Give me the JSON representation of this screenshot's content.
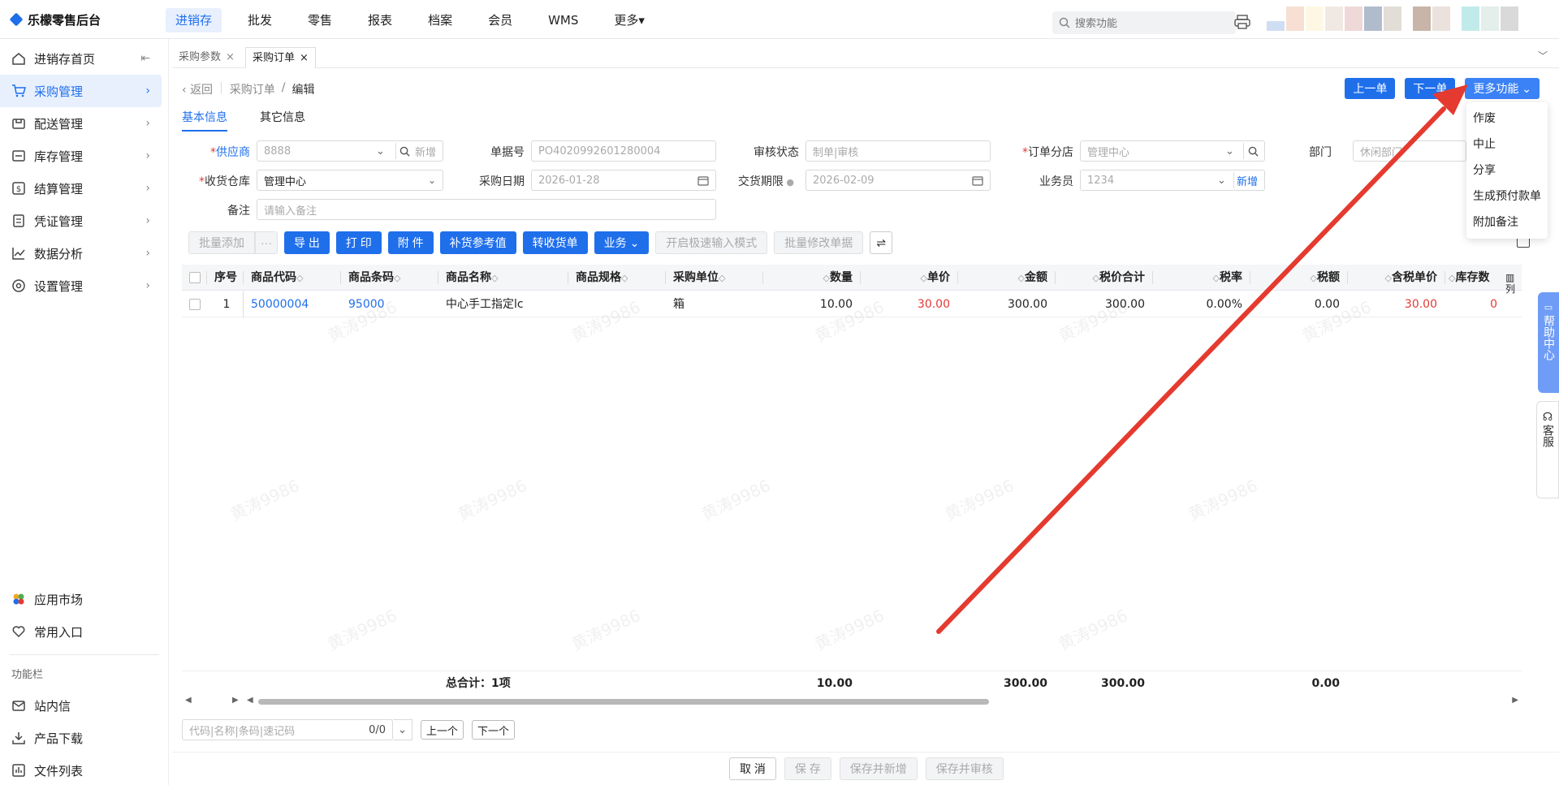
{
  "app": {
    "title": "乐檬零售后台"
  },
  "topnav": [
    {
      "label": "进销存",
      "active": true
    },
    {
      "label": "批发"
    },
    {
      "label": "零售"
    },
    {
      "label": "报表"
    },
    {
      "label": "档案"
    },
    {
      "label": "会员"
    },
    {
      "label": "WMS"
    },
    {
      "label": "更多▾"
    }
  ],
  "search": {
    "placeholder": "搜索功能"
  },
  "sidebar": {
    "items": [
      {
        "label": "进销存首页",
        "icon": "home-icon"
      },
      {
        "label": "采购管理",
        "icon": "cart-icon",
        "active": true
      },
      {
        "label": "配送管理",
        "icon": "delivery-icon"
      },
      {
        "label": "库存管理",
        "icon": "inventory-icon"
      },
      {
        "label": "结算管理",
        "icon": "settlement-icon"
      },
      {
        "label": "凭证管理",
        "icon": "voucher-icon"
      },
      {
        "label": "数据分析",
        "icon": "chart-icon"
      },
      {
        "label": "设置管理",
        "icon": "settings-icon"
      }
    ],
    "bottom": [
      {
        "label": "应用市场",
        "icon": "app-market-icon"
      },
      {
        "label": "常用入口",
        "icon": "heart-icon"
      }
    ],
    "section_label": "功能栏",
    "tools": [
      {
        "label": "站内信",
        "icon": "mail-icon"
      },
      {
        "label": "产品下载",
        "icon": "download-icon"
      },
      {
        "label": "文件列表",
        "icon": "file-list-icon"
      }
    ]
  },
  "tabs": [
    {
      "label": "采购参数",
      "close": "×"
    },
    {
      "label": "采购订单",
      "close": "×",
      "active": true
    }
  ],
  "breadcrumb": {
    "back": "返回",
    "parent": "采购订单",
    "sep": "/",
    "current": "编辑"
  },
  "actions": {
    "prev": "上一单",
    "next": "下一单",
    "more": "更多功能"
  },
  "more_menu": [
    "作废",
    "中止",
    "分享",
    "生成预付款单",
    "附加备注"
  ],
  "subtabs": [
    {
      "label": "基本信息",
      "active": true
    },
    {
      "label": "其它信息"
    }
  ],
  "form": {
    "supplier_label": "供应商",
    "supplier_value": "8888",
    "supplier_new": "新增",
    "doc_no_label": "单据号",
    "doc_no_value": "PO4020992601280004",
    "audit_label": "审核状态",
    "audit_placeholder": "制单|审核",
    "branch_label": "订单分店",
    "branch_value": "管理中心",
    "dept_label": "部门",
    "dept_placeholder": "休闲部门",
    "warehouse_label": "收货仓库",
    "warehouse_value": "管理中心",
    "purchase_date_label": "采购日期",
    "purchase_date_value": "2026-01-28",
    "delivery_label": "交货期限",
    "delivery_value": "2026-02-09",
    "staff_label": "业务员",
    "staff_value": "1234",
    "staff_new": "新增",
    "remark_label": "备注",
    "remark_placeholder": "请输入备注"
  },
  "toolbar": {
    "batch_add": "批量添加",
    "more": "···",
    "export": "导 出",
    "print": "打 印",
    "attach": "附 件",
    "replenish": "补货参考值",
    "to_receipt": "转收货单",
    "business": "业务",
    "quick_input": "开启极速输入模式",
    "batch_edit": "批量修改单据"
  },
  "table": {
    "headers": {
      "seq": "序号",
      "code": "商品代码",
      "barcode": "商品条码",
      "name": "商品名称",
      "spec": "商品规格",
      "unit": "采购单位",
      "qty": "数量",
      "price": "单价",
      "amount": "金额",
      "total": "税价合计",
      "tax_rate": "税率",
      "tax": "税额",
      "tax_price": "含税单价",
      "stock": "库存数"
    },
    "rows": [
      {
        "seq": "1",
        "code": "50000004",
        "barcode": "95000",
        "name": "中心手工指定lc",
        "spec": "",
        "unit": "箱",
        "qty": "10.00",
        "price": "30.00",
        "amount": "300.00",
        "total": "300.00",
        "tax_rate": "0.00%",
        "tax": "0.00",
        "tax_price": "30.00",
        "stock": "0"
      }
    ],
    "col_setting": "列"
  },
  "totals": {
    "label": "总合计：1项",
    "qty": "10.00",
    "amount": "300.00",
    "total": "300.00",
    "tax": "0.00"
  },
  "pager": {
    "placeholder": "代码|名称|条码|速记码",
    "count": "0/0",
    "prev": "上一个",
    "next": "下一个"
  },
  "footer": {
    "cancel": "取 消",
    "save": "保 存",
    "save_new": "保存并新增",
    "save_audit": "保存并审核"
  },
  "float": {
    "help": "帮助中心",
    "service": "客服"
  },
  "watermark": "黄涛9986",
  "colors": {
    "accent": "#1f6feb",
    "price_red": "#e53935",
    "arrow": "#e53a2f"
  }
}
